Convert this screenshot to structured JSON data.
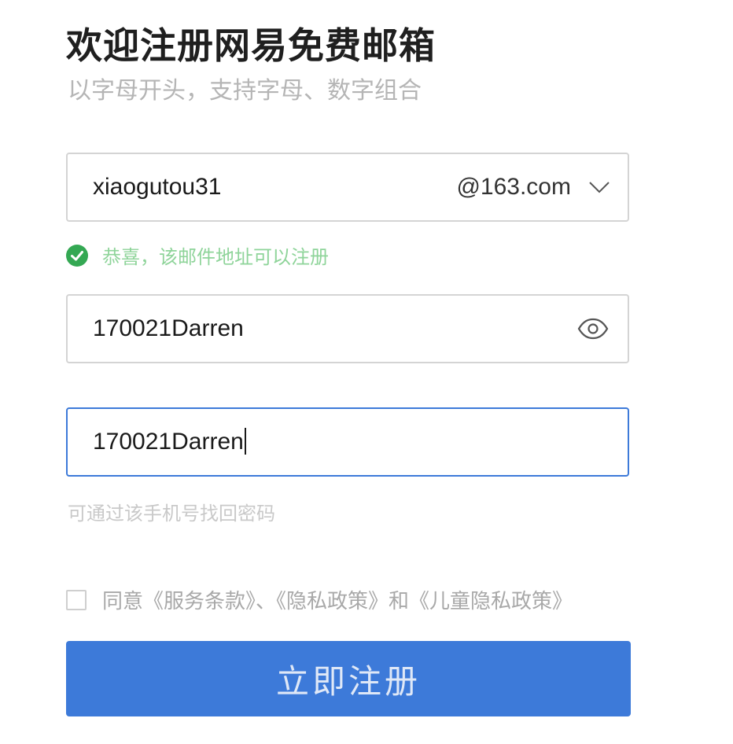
{
  "header": {
    "title": "欢迎注册网易免费邮箱",
    "subtitle": "以字母开头，支持字母、数字组合"
  },
  "email": {
    "value": "xiaogutou31",
    "domain": "@163.com",
    "domain_icon": "chevron-down-icon"
  },
  "email_status": {
    "icon": "check-circle-icon",
    "text": "恭喜，该邮件地址可以注册",
    "color": "#34a853"
  },
  "password": {
    "value": "170021Darren",
    "toggle_icon": "eye-icon"
  },
  "confirm": {
    "value": "170021Darren",
    "hint": "可通过该手机号找回密码"
  },
  "agreement": {
    "checked": false,
    "text": "同意《服务条款》、《隐私政策》和《儿童隐私政策》"
  },
  "submit": {
    "label": "立即注册",
    "color": "#3d7ad9"
  }
}
